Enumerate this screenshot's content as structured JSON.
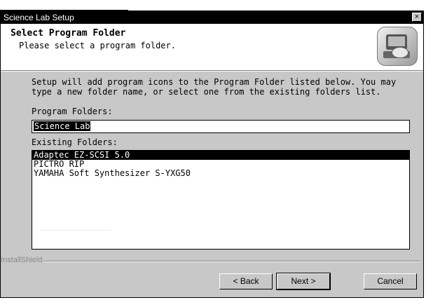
{
  "window": {
    "title": "Science Lab Setup",
    "close_glyph": "×"
  },
  "header": {
    "title": "Select Program Folder",
    "subtitle": "Please select a program folder.",
    "icon": "setup-computer-icon"
  },
  "body": {
    "description": "Setup will add program icons to the Program Folder listed below. You may type a new folder name, or select one from the existing folders list.",
    "program_folders_label": "Program Folders:",
    "program_folder_value": "Science Lab",
    "existing_folders_label": "Existing Folders:",
    "existing_folders": [
      "Adaptec EZ-SCSI 5.0",
      "PICTRO RIP",
      "YAMAHA Soft Synthesizer S-YXG50"
    ],
    "selected_folder": "Adaptec EZ-SCSI 5.0"
  },
  "footer": {
    "brand": "InstallShield",
    "back_label": "< Back",
    "next_label": "Next >",
    "cancel_label": "Cancel"
  }
}
